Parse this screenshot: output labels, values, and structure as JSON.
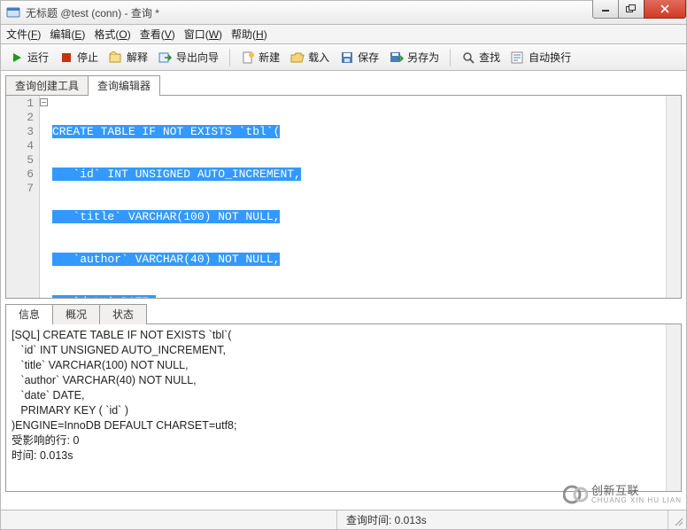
{
  "window": {
    "title": "无标题 @test (conn) - 查询 *"
  },
  "menu": {
    "file": "文件(",
    "file_u": "F",
    "file2": ")",
    "edit": "编辑(",
    "edit_u": "E",
    "edit2": ")",
    "format": "格式(",
    "format_u": "O",
    "format2": ")",
    "view": "查看(",
    "view_u": "V",
    "view2": ")",
    "window": "窗口(",
    "window_u": "W",
    "window2": ")",
    "help": "帮助(",
    "help_u": "H",
    "help2": ")"
  },
  "toolbar": {
    "run": "运行",
    "stop": "停止",
    "explain": "解释",
    "export_wizard": "导出向导",
    "new": "新建",
    "load": "载入",
    "save": "保存",
    "save_as": "另存为",
    "find": "查找",
    "auto_wrap": "自动换行"
  },
  "editor_tabs": {
    "builder": "查询创建工具",
    "editor": "查询编辑器"
  },
  "code_lines": [
    "CREATE TABLE IF NOT EXISTS `tbl`(",
    "   `id` INT UNSIGNED AUTO_INCREMENT,",
    "   `title` VARCHAR(100) NOT NULL,",
    "   `author` VARCHAR(40) NOT NULL,",
    "   `date` DATE,",
    "   PRIMARY KEY ( `id` )",
    ")ENGINE=InnoDB DEFAULT CHARSET=utf8;"
  ],
  "line_numbers": [
    "1",
    "2",
    "3",
    "4",
    "5",
    "6",
    "7"
  ],
  "bottom_tabs": {
    "info": "信息",
    "profile": "概况",
    "status": "状态"
  },
  "info_text": "[SQL] CREATE TABLE IF NOT EXISTS `tbl`(\n   `id` INT UNSIGNED AUTO_INCREMENT,\n   `title` VARCHAR(100) NOT NULL,\n   `author` VARCHAR(40) NOT NULL,\n   `date` DATE,\n   PRIMARY KEY ( `id` )\n)ENGINE=InnoDB DEFAULT CHARSET=utf8;\n受影响的行: 0\n时间: 0.013s",
  "statusbar": {
    "query_time": "查询时间: 0.013s"
  },
  "watermark": {
    "brand": "创新互联",
    "sub": "CHUANG XIN HU LIAN"
  }
}
